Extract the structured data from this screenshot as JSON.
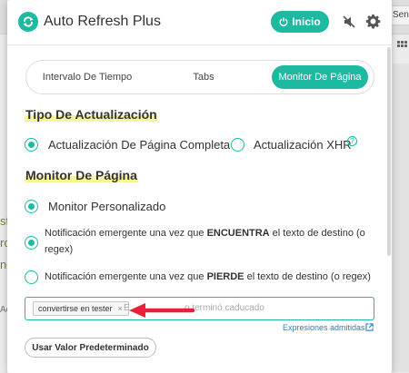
{
  "background": {
    "tab_text": "Sens",
    "left_fragments": [
      "st",
      "ro",
      "ng"
    ],
    "left_small": "Ac"
  },
  "header": {
    "title": "Auto Refresh Plus",
    "start_label": "Inicio",
    "icons": [
      "refresh-logo-icon",
      "power-icon",
      "mute-icon",
      "gear-icon"
    ]
  },
  "tabs": [
    {
      "label": "Intervalo De Tiempo",
      "active": false
    },
    {
      "label": "Tabs",
      "active": false
    },
    {
      "label": "Monitor De Página",
      "active": true
    }
  ],
  "update_type": {
    "title": "Tipo De Actualización",
    "options": [
      {
        "label": "Actualización De Página Completa",
        "selected": true
      },
      {
        "label": "Actualización XHR",
        "selected": false
      }
    ],
    "help": "?"
  },
  "monitor": {
    "title": "Monitor De Página",
    "custom_label": "Monitor Personalizado",
    "notify_found_label": "Notificación emergente una vez que ENCUENTRA el texto de destino (o regex)",
    "notify_lost_label": "Notificación emergente una vez que PIERDE el texto de destino (o regex)"
  },
  "target_input": {
    "tag": "convertirse en tester",
    "tag_remove": "×",
    "ghost_prefix": "E",
    "ghost_text": "o terminó caducado"
  },
  "regex_link": "Expresiones admitidas",
  "default_button": "Usar Valor Predeterminado",
  "colors": {
    "accent": "#1db9a1",
    "highlight": "#f5f59a",
    "arrow": "#e8213a",
    "link": "#2a7fbf"
  }
}
